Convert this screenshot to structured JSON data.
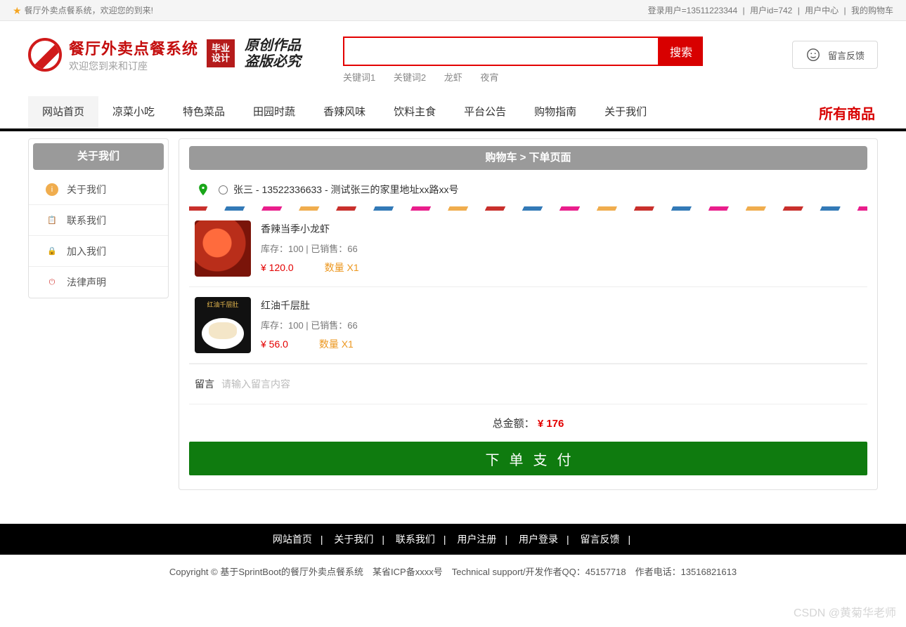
{
  "topbar": {
    "welcome": "餐厅外卖点餐系统，欢迎您的到来!",
    "login_user_label": "登录用户=13511223344",
    "uid_label": "用户id=742",
    "user_center": "用户中心",
    "my_cart": "我的购物车"
  },
  "brand": {
    "title": "餐厅外卖点餐系统",
    "subtitle": "欢迎您到来和订座",
    "badge_line1": "毕业",
    "badge_line2": "设计",
    "slogan_line1": "原创作品",
    "slogan_line2": "盗版必究"
  },
  "search": {
    "button": "搜索",
    "placeholder": "",
    "keywords": [
      "关键词1",
      "关键词2",
      "龙虾",
      "夜宵"
    ]
  },
  "feedback_label": "留言反馈",
  "nav": {
    "items": [
      "网站首页",
      "凉菜小吃",
      "特色菜品",
      "田园时蔬",
      "香辣风味",
      "饮料主食",
      "平台公告",
      "购物指南",
      "关于我们"
    ],
    "all_products": "所有商品"
  },
  "sidebar": {
    "title": "关于我们",
    "items": [
      {
        "icon": "info-icon",
        "color": "#f0ad4e",
        "label": "关于我们"
      },
      {
        "icon": "doc-icon",
        "color": "#5bc0de",
        "label": "联系我们"
      },
      {
        "icon": "lock-icon",
        "color": "#d9534f",
        "label": "加入我们"
      },
      {
        "icon": "power-icon",
        "color": "#d9534f",
        "label": "法律声明"
      }
    ]
  },
  "order": {
    "title": "购物车 > 下单页面",
    "address_text": "张三 - 13522336633 - 测试张三的家里地址xx路xx号",
    "items": [
      {
        "name": "香辣当季小龙虾",
        "stock_label": "库存：100 | 已销售：66",
        "price": "¥ 120.0",
        "qty": "数量 X1",
        "img_class": "food1"
      },
      {
        "name": "红油千层肚",
        "stock_label": "库存：100 | 已销售：66",
        "price": "¥ 56.0",
        "qty": "数量 X1",
        "img_class": "food2",
        "img_caption": "红油千层肚"
      }
    ],
    "msg_label": "留言",
    "msg_placeholder": "请输入留言内容",
    "total_label": "总金额：",
    "total_amount": "¥ 176",
    "pay_button": "下单支付"
  },
  "footer": {
    "links": [
      "网站首页",
      "关于我们",
      "联系我们",
      "用户注册",
      "用户登录",
      "留言反馈"
    ],
    "copyright": "Copyright © 基于SprintBoot的餐厅外卖点餐系统　某省ICP备xxxx号　Technical support/开发作者QQ：45157718　作者电话：13516821613"
  },
  "watermark": "CSDN @黄菊华老师"
}
